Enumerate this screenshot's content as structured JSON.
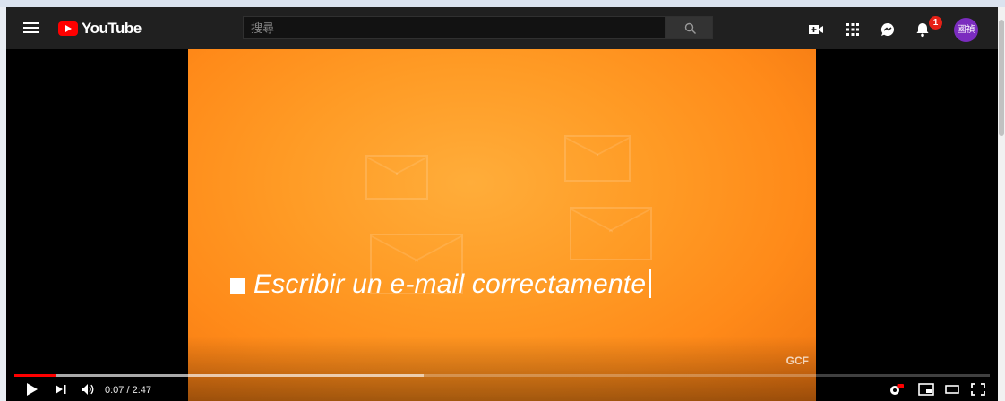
{
  "site": {
    "logo_text": "YouTube",
    "brand_color": "#ff0000"
  },
  "search": {
    "placeholder": "搜尋"
  },
  "header": {
    "notifications_count": "1",
    "avatar_label": "國禎"
  },
  "video": {
    "title_line": "Escribir un e-mail correctamente",
    "watermark": "GCF",
    "current_time": "0:07",
    "duration": "2:47",
    "time_display": "0:07 / 2:47",
    "progress_fraction": 0.042,
    "buffer_fraction": 0.42
  },
  "icons": [
    "menu-icon",
    "youtube-logo-icon",
    "search-icon",
    "create-video-icon",
    "apps-grid-icon",
    "messages-icon",
    "notifications-bell-icon",
    "play-icon",
    "next-icon",
    "volume-icon",
    "settings-hd-icon",
    "miniplayer-icon",
    "theater-mode-icon",
    "fullscreen-icon"
  ]
}
